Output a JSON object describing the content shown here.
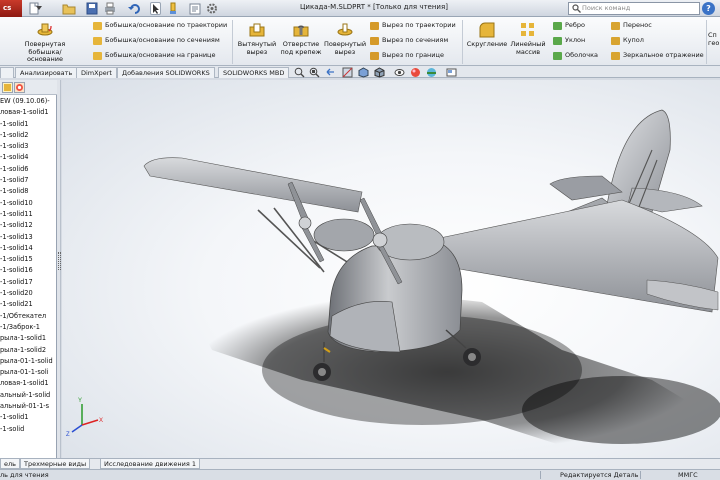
{
  "app": {
    "logo_text": "cs",
    "document_title": "Цикада-M.SLDPRT * [Только для чтения]",
    "search_placeholder": "Поиск команд",
    "help_symbol": "?"
  },
  "ribbon": {
    "boss_sweep_label": "Повернутая бобышка/основание",
    "boss_options": [
      "Бобышка/основание по траектории",
      "Бобышка/основание по сечениям",
      "Бобышка/основание на границе"
    ],
    "extruded_cut": "Вытянутый вырез",
    "hole_wizard": "Отверстие под крепеж",
    "revolved_cut": "Повернутый вырез",
    "cut_options": [
      "Вырез по траектории",
      "Вырез по сечениям",
      "Вырез по границе"
    ],
    "fillet": "Скругление",
    "linear_pattern": "Линейный массив",
    "rib_group": [
      "Ребро",
      "Уклон",
      "Оболочка"
    ],
    "wrap_group": [
      "Перенос",
      "Купол",
      "Зеркальное отражение"
    ],
    "right_cut": "Сп\nгео"
  },
  "tabs": [
    "Анализировать",
    "DimXpert",
    "Добавления SOLIDWORKS",
    "SOLIDWORKS MBD"
  ],
  "tree": {
    "items": [
      "EW (09.10.06)-",
      "ловая-1-solid1",
      "-1-solid1",
      "-1-solid2",
      "-1-solid3",
      "-1-solid4",
      "-1-solid6",
      "-1-solid7",
      "-1-solid8",
      "-1-solid10",
      "-1-solid11",
      "-1-solid12",
      "-1-solid13",
      "-1-solid14",
      "-1-solid15",
      "-1-solid16",
      "-1-solid17",
      "-1-solid20",
      "-1-solid21",
      "-1/Обтекател",
      "-1/Заброк-1",
      "рыла-1-solid1",
      "рыла-1-solid2",
      "рыла-01-1-solid",
      "рыла-01-1-soli",
      "ловая-1-solid1",
      "альный-1-solid",
      "альный-01-1-s",
      "-1-solid1",
      "-1-solid"
    ]
  },
  "bottom_tabs": [
    "ель",
    "Трехмерные виды",
    "Исследование движения 1"
  ],
  "status": {
    "left": "ль для чтения",
    "mode": "Редактируется Деталь",
    "units": "ММГС"
  },
  "colors": {
    "ribbon_bg": "#eef1f5",
    "viewport_bg": "#f4f6f9",
    "model_gray": "#9a9da3",
    "accent_blue": "#3b73c6",
    "logo_red": "#b3271b"
  }
}
